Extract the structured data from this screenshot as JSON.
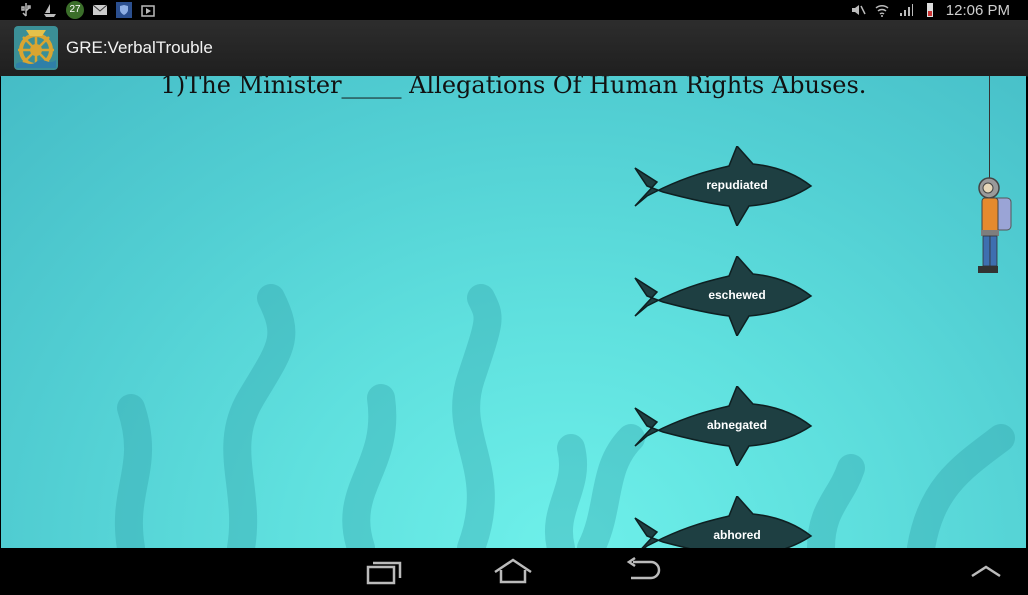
{
  "status_bar": {
    "notification_count": "27",
    "time": "12:06 PM"
  },
  "action_bar": {
    "title": "GRE:VerbalTrouble"
  },
  "game": {
    "question": "1)The Minister_____ Allegations Of Human Rights Abuses.",
    "options": [
      {
        "label": "repudiated"
      },
      {
        "label": "eschewed"
      },
      {
        "label": "abnegated"
      },
      {
        "label": "abhored"
      }
    ]
  },
  "colors": {
    "fish": "#1e3f42",
    "sea_top": "#45bcc6",
    "sea_bottom": "#6ef0ea",
    "diver_suit": "#e58a2e",
    "tank": "#9aa4d6"
  },
  "icons": {
    "status_left": [
      "usb-icon",
      "sailboat-icon",
      "notification-badge",
      "mail-icon",
      "shield-icon",
      "media-icon"
    ],
    "status_right": [
      "mute-icon",
      "wifi-icon",
      "signal-icon",
      "battery-icon"
    ],
    "nav": [
      "recent-apps-icon",
      "home-icon",
      "back-icon",
      "chevron-up-icon"
    ]
  }
}
